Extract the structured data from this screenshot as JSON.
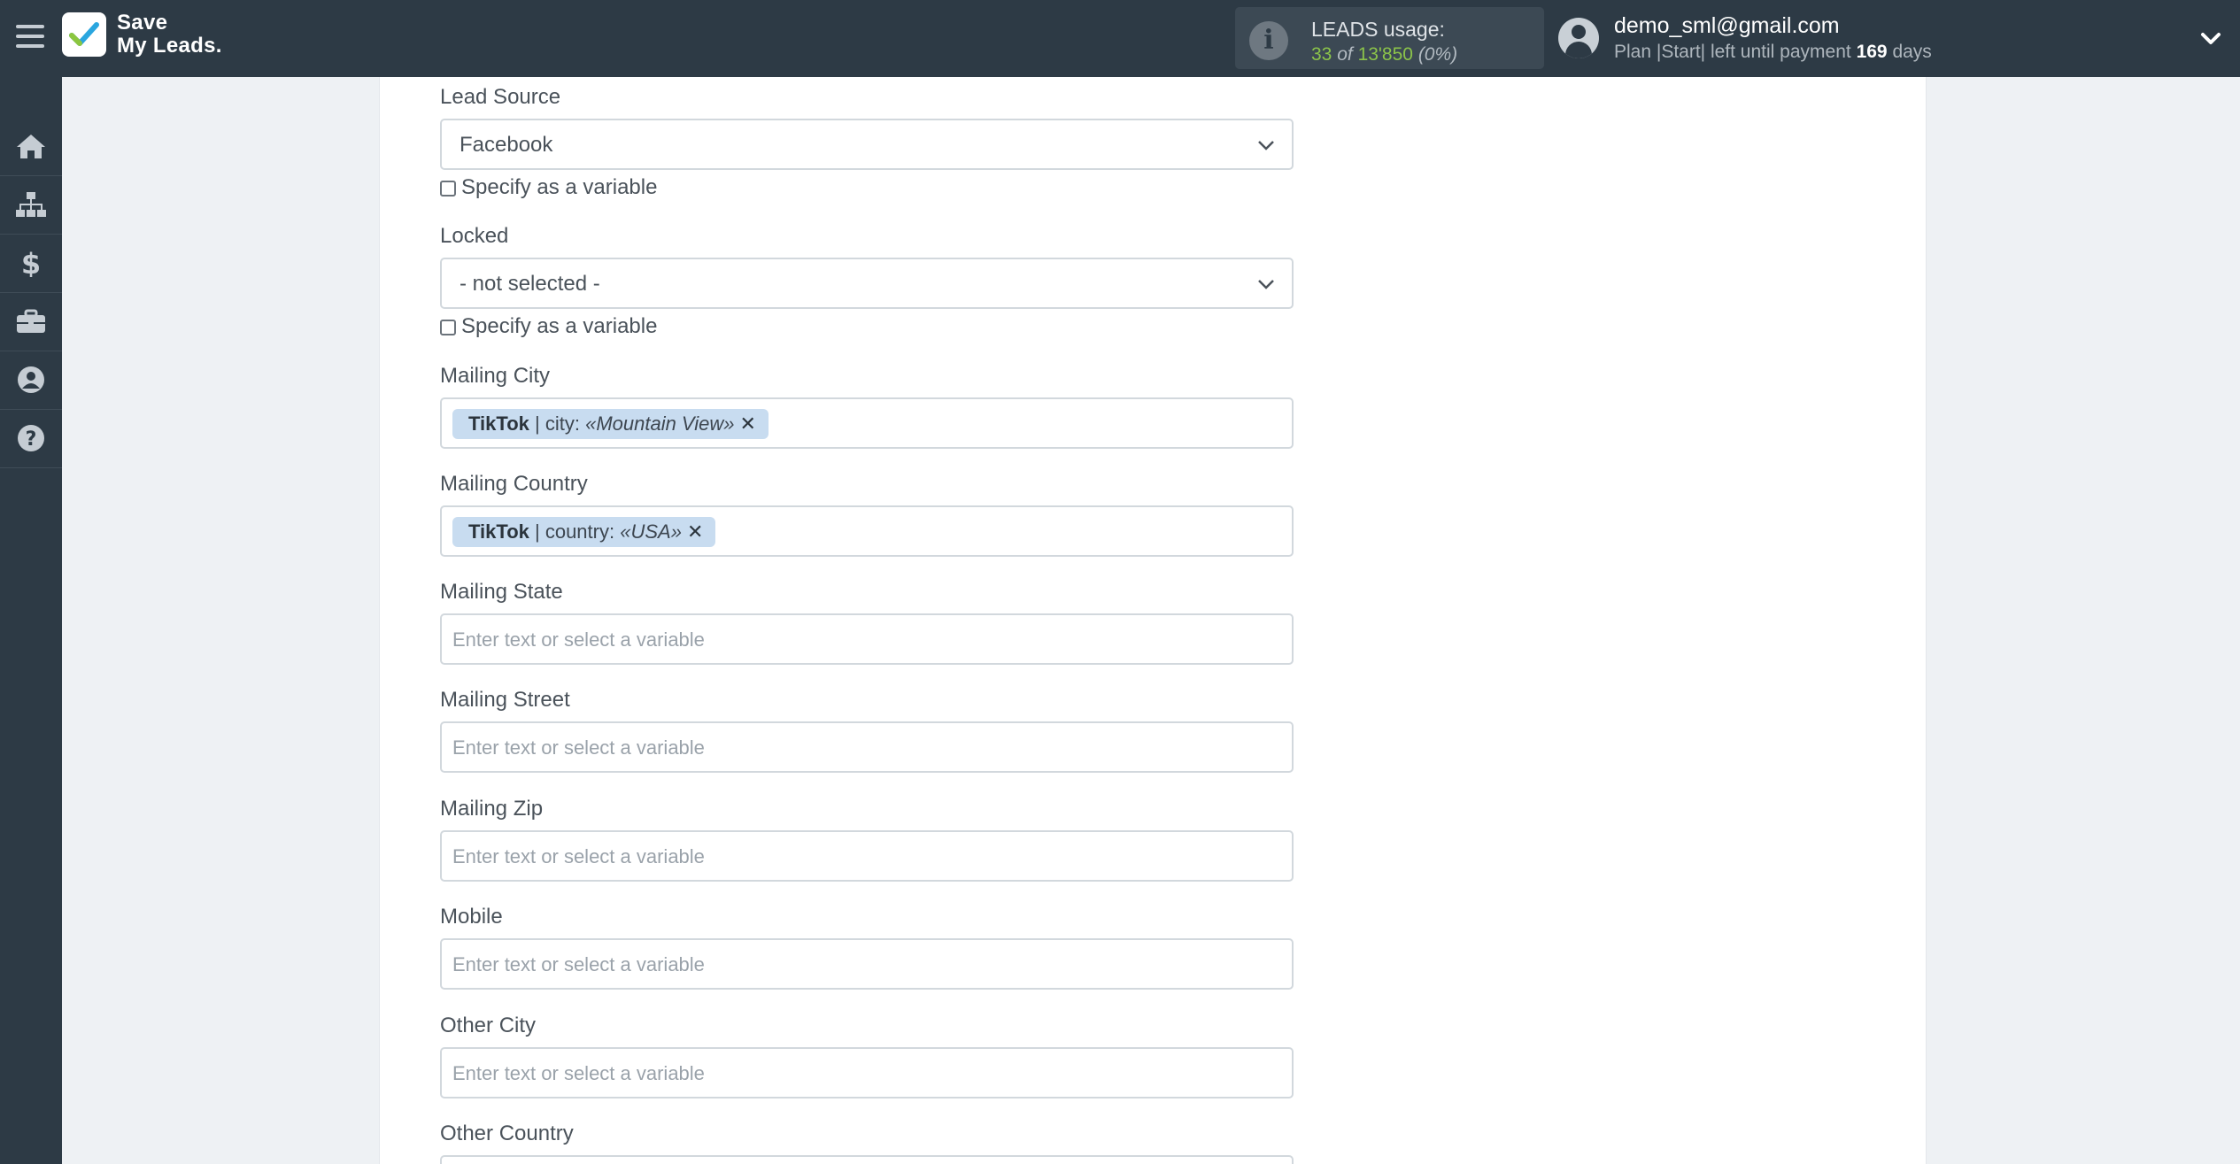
{
  "app": {
    "logo_line1": "Save",
    "logo_line2": "My Leads."
  },
  "usage": {
    "title": "LEADS usage:",
    "used": "33",
    "of_word": "of",
    "total": "13'850",
    "percent": "(0%)"
  },
  "user": {
    "email": "demo_sml@gmail.com",
    "plan_prefix": "Plan |Start| left until payment",
    "days_count": "169",
    "days_word": "days"
  },
  "sidebar": {
    "items": [
      {
        "icon": "home-icon"
      },
      {
        "icon": "sitemap-icon"
      },
      {
        "icon": "dollar-icon"
      },
      {
        "icon": "briefcase-icon"
      },
      {
        "icon": "user-circle-icon"
      },
      {
        "icon": "question-circle-icon"
      }
    ]
  },
  "form": {
    "lead_source": {
      "label": "Lead Source",
      "value": "Facebook",
      "checkbox_label": "Specify as a variable"
    },
    "locked": {
      "label": "Locked",
      "value": "- not selected -",
      "checkbox_label": "Specify as a variable"
    },
    "mailing_city": {
      "label": "Mailing City",
      "chip_source": "TikTok",
      "chip_field": "| city:",
      "chip_value": "«Mountain View»"
    },
    "mailing_country": {
      "label": "Mailing Country",
      "chip_source": "TikTok",
      "chip_field": "| country:",
      "chip_value": "«USA»"
    },
    "mailing_state": {
      "label": "Mailing State",
      "placeholder": "Enter text or select a variable"
    },
    "mailing_street": {
      "label": "Mailing Street",
      "placeholder": "Enter text or select a variable"
    },
    "mailing_zip": {
      "label": "Mailing Zip",
      "placeholder": "Enter text or select a variable"
    },
    "mobile": {
      "label": "Mobile",
      "placeholder": "Enter text or select a variable"
    },
    "other_city": {
      "label": "Other City",
      "placeholder": "Enter text or select a variable"
    },
    "other_country": {
      "label": "Other Country"
    }
  },
  "colors": {
    "topbar": "#2d3a45",
    "usage_accent": "#8bc34a",
    "chip_bg": "#c8dcf0"
  }
}
